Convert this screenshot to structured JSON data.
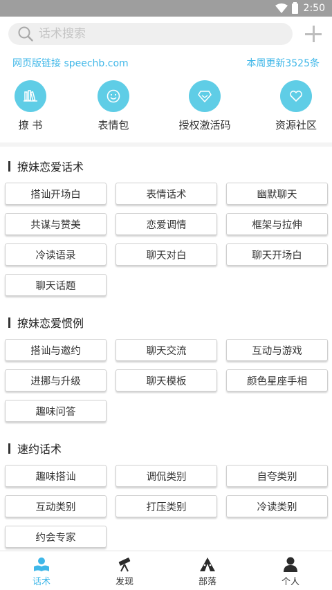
{
  "status": {
    "time": "2:50"
  },
  "search": {
    "placeholder": "话术搜索"
  },
  "links": {
    "web_label": "网页版链接  speechb.com",
    "update_label": "本周更新3525条"
  },
  "shortcuts": [
    {
      "label": "撩 书",
      "icon": "books-icon"
    },
    {
      "label": "表情包",
      "icon": "smiley-icon"
    },
    {
      "label": "授权激活码",
      "icon": "diamond-icon"
    },
    {
      "label": "资源社区",
      "icon": "heart-icon"
    }
  ],
  "sections": [
    {
      "title": "撩妹恋爱话术",
      "tags": [
        "搭讪开场白",
        "表情话术",
        "幽默聊天",
        "共谋与赞美",
        "恋爱调情",
        "框架与拉伸",
        "冷读语录",
        "聊天对白",
        "聊天开场白",
        "聊天话题"
      ]
    },
    {
      "title": "撩妹恋爱惯例",
      "tags": [
        "搭讪与邀约",
        "聊天交流",
        "互动与游戏",
        "进挪与升级",
        "聊天模板",
        "颜色星座手相",
        "趣味问答"
      ]
    },
    {
      "title": "速约话术",
      "tags": [
        "趣味搭讪",
        "调侃类别",
        "自夸类别",
        "互动类别",
        "打压类别",
        "冷读类别",
        "约会专家"
      ]
    }
  ],
  "tabs": [
    {
      "label": "话术",
      "icon": "reader-icon",
      "active": true
    },
    {
      "label": "发现",
      "icon": "telescope-icon",
      "active": false
    },
    {
      "label": "部落",
      "icon": "tent-icon",
      "active": false
    },
    {
      "label": "个人",
      "icon": "person-icon",
      "active": false
    }
  ],
  "colors": {
    "accent": "#3fb7e8",
    "icon_circle": "#5fcde6",
    "status_bar": "#9e9e9e"
  }
}
